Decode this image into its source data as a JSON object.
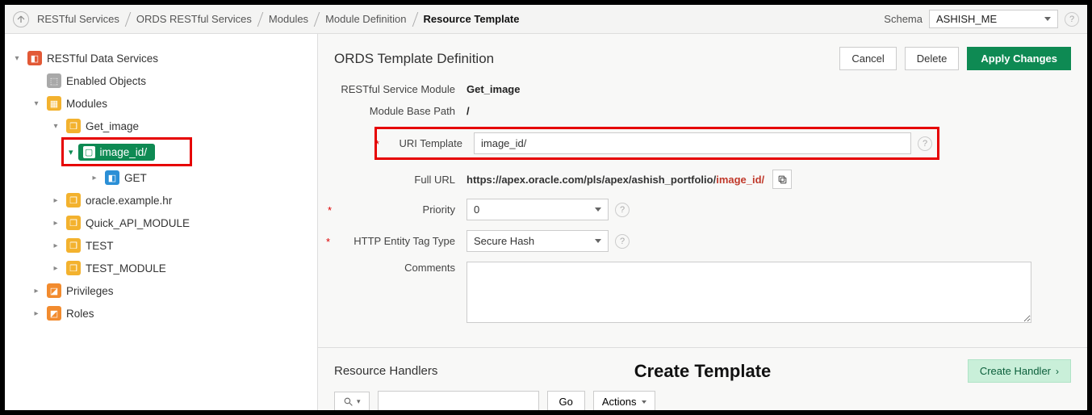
{
  "breadcrumb": {
    "items": [
      "RESTful Services",
      "ORDS RESTful Services",
      "Modules",
      "Module Definition",
      "Resource Template"
    ]
  },
  "schema": {
    "label": "Schema",
    "value": "ASHISH_ME"
  },
  "sidebar": {
    "root": "RESTful Data Services",
    "items": {
      "enabled_objects": "Enabled Objects",
      "modules": "Modules",
      "get_image": "Get_image",
      "image_id": "image_id/",
      "get": "GET",
      "oracle_example_hr": "oracle.example.hr",
      "quick_api": "Quick_API_MODULE",
      "test": "TEST",
      "test_module": "TEST_MODULE",
      "privileges": "Privileges",
      "roles": "Roles"
    }
  },
  "main": {
    "title": "ORDS Template Definition",
    "cancel": "Cancel",
    "delete": "Delete",
    "apply": "Apply Changes",
    "form": {
      "module_label": "RESTful Service Module",
      "module_value": "Get_image",
      "base_path_label": "Module Base Path",
      "base_path_value": "/",
      "uri_template_label": "URI Template",
      "uri_template_value": "image_id/",
      "full_url_label": "Full URL",
      "full_url_prefix": "https://apex.oracle.com/pls/apex/ashish_portfolio/",
      "full_url_suffix": "image_id/",
      "priority_label": "Priority",
      "priority_value": "0",
      "etag_label": "HTTP Entity Tag Type",
      "etag_value": "Secure Hash",
      "comments_label": "Comments",
      "comments_value": ""
    },
    "sub": {
      "title": "Resource Handlers",
      "banner": "Create Template",
      "create_handler": "Create Handler"
    },
    "toolbar": {
      "go": "Go",
      "actions": "Actions",
      "search_value": ""
    }
  }
}
